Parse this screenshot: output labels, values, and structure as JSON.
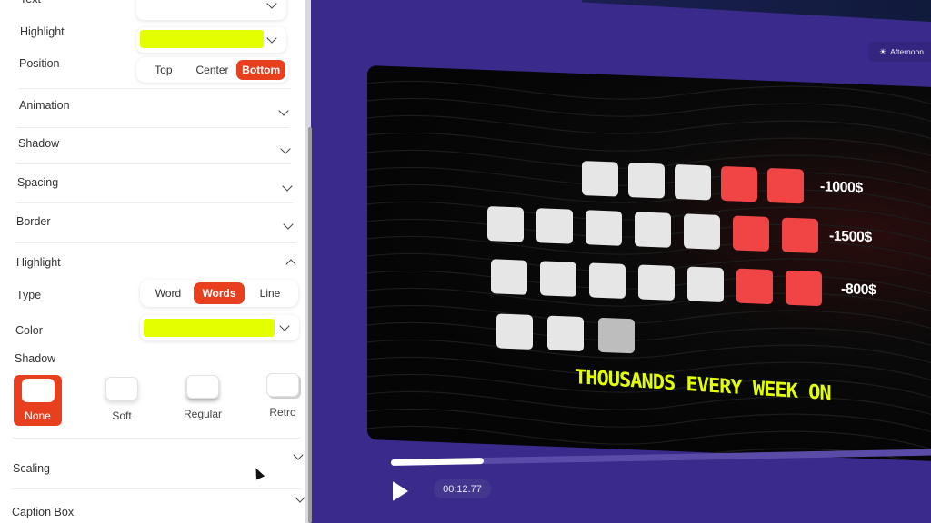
{
  "panel": {
    "text_label": "Text",
    "highlight_label": "Highlight",
    "highlight_color": "#e4ff00",
    "position": {
      "label": "Position",
      "options": [
        "Top",
        "Center",
        "Bottom"
      ],
      "selected": "Bottom"
    },
    "sections": {
      "animation": "Animation",
      "shadow": "Shadow",
      "spacing": "Spacing",
      "border": "Border",
      "highlight": "Highlight",
      "scaling": "Scaling",
      "caption_box": "Caption Box"
    },
    "highlight_section": {
      "type_label": "Type",
      "type_options": [
        "Word",
        "Words",
        "Line"
      ],
      "type_selected": "Words",
      "color_label": "Color",
      "color_value": "#e4ff00",
      "shadow_label": "Shadow",
      "shadow_options": [
        "None",
        "Soft",
        "Regular",
        "Retro"
      ],
      "shadow_selected": "None"
    }
  },
  "preview": {
    "badge_label": "Afternoon",
    "badge_icon": "sun-horizon-icon",
    "rows": [
      {
        "tiles": [
          "white",
          "white",
          "white",
          "red",
          "red"
        ],
        "amount": "-1000$"
      },
      {
        "tiles": [
          "white",
          "white",
          "white",
          "white",
          "white",
          "red",
          "red"
        ],
        "amount": "-1500$"
      },
      {
        "tiles": [
          "white",
          "white",
          "white",
          "white",
          "white",
          "red",
          "red"
        ],
        "amount": "-800$"
      },
      {
        "tiles": [
          "white",
          "white",
          "dim"
        ],
        "amount": ""
      }
    ],
    "caption": "THOUSANDS EVERY WEEK ON",
    "playback": {
      "time": "00:12.77",
      "progress": 0.17,
      "play_icon": "play-icon"
    }
  },
  "colors": {
    "accent": "#e8401f",
    "background": "#3a2a8c",
    "tile_red": "#f14545",
    "caption_yellow": "#e4ff00"
  }
}
